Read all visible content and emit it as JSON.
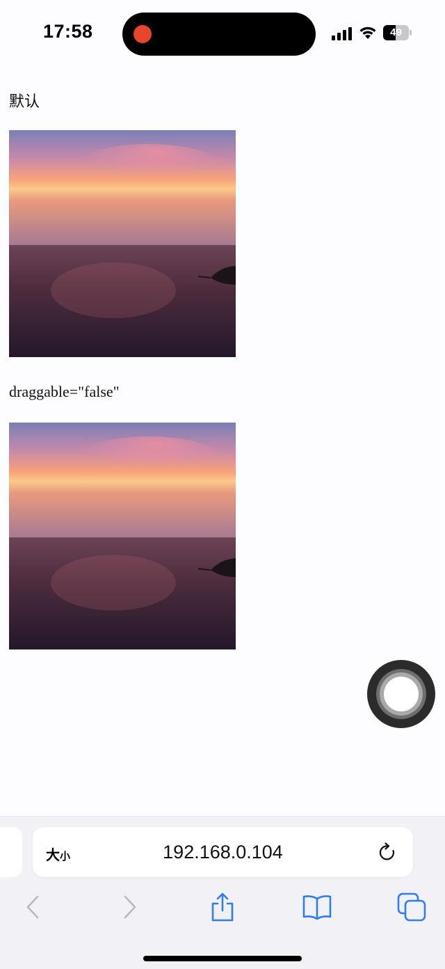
{
  "status_bar": {
    "time": "17:58",
    "battery_level": "49",
    "battery_fraction": 0.49,
    "icons": [
      "screen-recording-icon",
      "cellular-signal-icon",
      "wifi-icon",
      "battery-icon"
    ]
  },
  "content": {
    "sections": [
      {
        "label": "默认",
        "image": "sunset-over-sea-photo"
      },
      {
        "label": "draggable=\"false\"",
        "image": "sunset-over-sea-photo"
      }
    ]
  },
  "browser": {
    "text_size_label_large": "大",
    "text_size_label_small": "小",
    "url": "192.168.0.104",
    "toolbar": [
      "back-icon",
      "forward-icon",
      "share-icon",
      "bookmarks-icon",
      "tabs-icon"
    ]
  },
  "colors": {
    "record_dot": "#e8452c",
    "accent_blue": "#2f7cf6",
    "disabled_gray": "#b8b8bd"
  }
}
